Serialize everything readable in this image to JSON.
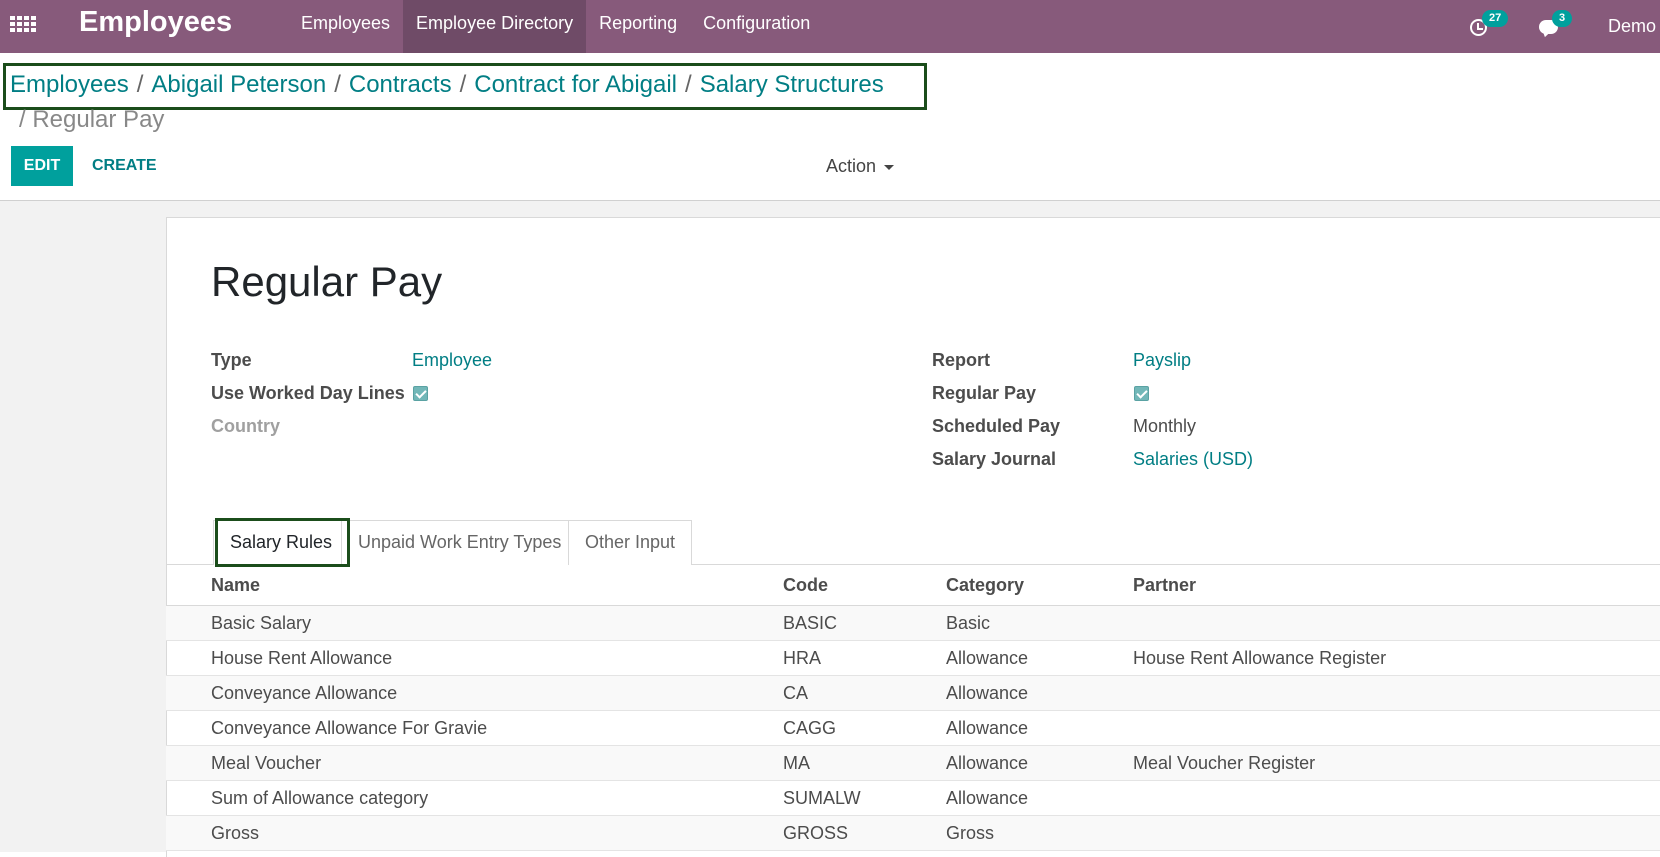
{
  "navbar": {
    "app_title": "Employees",
    "menu": [
      "Employees",
      "Employee Directory",
      "Reporting",
      "Configuration"
    ],
    "activities_count": "27",
    "messages_count": "3",
    "user_name": "Demo",
    "bg_color": "#875a7b"
  },
  "breadcrumb": {
    "items": [
      "Employees",
      "Abigail Peterson",
      "Contracts",
      "Contract for Abigail",
      "Salary Structures"
    ],
    "separator": "/",
    "current": "Regular Pay"
  },
  "controls": {
    "edit_label": "EDIT",
    "create_label": "CREATE",
    "action_label": "Action"
  },
  "record": {
    "title": "Regular Pay",
    "left_fields": {
      "type_label": "Type",
      "type_value": "Employee",
      "worked_days_label": "Use Worked Day Lines",
      "worked_days_checked": true,
      "country_label": "Country"
    },
    "right_fields": {
      "report_label": "Report",
      "report_value": "Payslip",
      "regular_pay_label": "Regular Pay",
      "regular_pay_checked": true,
      "scheduled_pay_label": "Scheduled Pay",
      "scheduled_pay_value": "Monthly",
      "journal_label": "Salary Journal",
      "journal_value": "Salaries (USD)"
    }
  },
  "tabs": [
    "Salary Rules",
    "Unpaid Work Entry Types",
    "Other Input"
  ],
  "active_tab": "Salary Rules",
  "table": {
    "headers": [
      "Name",
      "Code",
      "Category",
      "Partner"
    ],
    "rows": [
      [
        "Basic Salary",
        "BASIC",
        "Basic",
        ""
      ],
      [
        "House Rent Allowance",
        "HRA",
        "Allowance",
        "House Rent Allowance Register"
      ],
      [
        "Conveyance Allowance",
        "CA",
        "Allowance",
        ""
      ],
      [
        "Conveyance Allowance For Gravie",
        "CAGG",
        "Allowance",
        ""
      ],
      [
        "Meal Voucher",
        "MA",
        "Allowance",
        "Meal Voucher Register"
      ],
      [
        "Sum of Allowance category",
        "SUMALW",
        "Allowance",
        ""
      ],
      [
        "Gross",
        "GROSS",
        "Gross",
        ""
      ]
    ]
  }
}
